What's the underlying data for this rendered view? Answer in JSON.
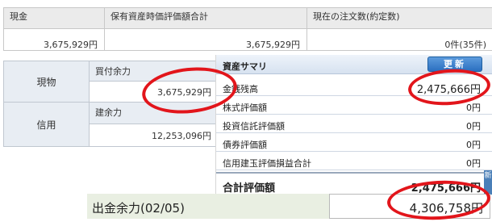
{
  "summary_table": {
    "headers": [
      "現金",
      "保有資産時価評価額合計",
      "現在の注文数(約定数)"
    ],
    "values": [
      "3,675,929円",
      "3,675,929円",
      "0件(35件)"
    ]
  },
  "capacity_table": {
    "rows": [
      {
        "label": "現物",
        "sub_label": "買付余力",
        "value": "3,675,929円"
      },
      {
        "label": "信用",
        "sub_label": "建余力",
        "value": "12,253,096円"
      }
    ]
  },
  "asset_summary": {
    "title": "資産サマリ",
    "refresh_label": "更新",
    "items": [
      {
        "label": "金銭残高",
        "value": "2,475,666円"
      },
      {
        "label": "株式評価額",
        "value": "0円"
      },
      {
        "label": "投資信託評価額",
        "value": "0円"
      },
      {
        "label": "債券評価額",
        "value": "0円"
      },
      {
        "label": "信用建玉評価損益合計",
        "value": "0円"
      }
    ],
    "total_label": "合計評価額",
    "total_value": "2,475,666円",
    "edge_tab_label": "新"
  },
  "withdrawal": {
    "label": "出金余力(02/05)",
    "value": "4,306,758円"
  },
  "annotation_color": "#e2151b"
}
